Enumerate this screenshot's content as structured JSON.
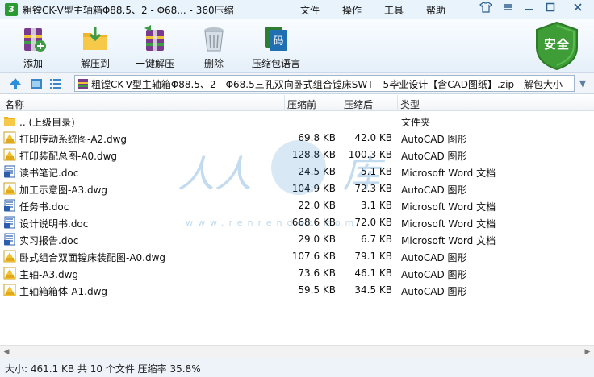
{
  "window": {
    "title": "粗镗CK-V型主轴箱Φ88.5、2 - Φ68... - 360压缩",
    "menu": [
      "文件",
      "操作",
      "工具",
      "帮助"
    ]
  },
  "toolbar": {
    "buttons": [
      {
        "label": "添加",
        "icon": "add-archive-icon"
      },
      {
        "label": "解压到",
        "icon": "extract-to-icon"
      },
      {
        "label": "一键解压",
        "icon": "one-click-extract-icon"
      },
      {
        "label": "删除",
        "icon": "trash-icon"
      },
      {
        "label": "压缩包语言",
        "icon": "archive-language-icon"
      }
    ],
    "security_label": "安全"
  },
  "address": {
    "path": "粗镗CK-V型主轴箱Φ88.5、2 - Φ68.5三孔双向卧式组合镗床SWT—5毕业设计【含CAD图纸】.zip - 解包大小"
  },
  "columns": {
    "name": "名称",
    "compressed": "压缩前",
    "packed": "压缩后",
    "type": "类型"
  },
  "files": [
    {
      "name": ".. (上级目录)",
      "before": "",
      "after": "",
      "type": "文件夹",
      "kind": "folder"
    },
    {
      "name": "打印传动系统图-A2.dwg",
      "before": "69.8 KB",
      "after": "42.0 KB",
      "type": "AutoCAD 图形",
      "kind": "dwg"
    },
    {
      "name": "打印装配总图-A0.dwg",
      "before": "128.8 KB",
      "after": "100.3 KB",
      "type": "AutoCAD 图形",
      "kind": "dwg"
    },
    {
      "name": "读书笔记.doc",
      "before": "24.5 KB",
      "after": "5.1 KB",
      "type": "Microsoft Word 文档",
      "kind": "doc"
    },
    {
      "name": "加工示意图-A3.dwg",
      "before": "104.9 KB",
      "after": "72.3 KB",
      "type": "AutoCAD 图形",
      "kind": "dwg"
    },
    {
      "name": "任务书.doc",
      "before": "22.0 KB",
      "after": "3.1 KB",
      "type": "Microsoft Word 文档",
      "kind": "doc"
    },
    {
      "name": "设计说明书.doc",
      "before": "668.6 KB",
      "after": "72.0 KB",
      "type": "Microsoft Word 文档",
      "kind": "doc"
    },
    {
      "name": "实习报告.doc",
      "before": "29.0 KB",
      "after": "6.7 KB",
      "type": "Microsoft Word 文档",
      "kind": "doc"
    },
    {
      "name": "卧式组合双面镗床装配图-A0.dwg",
      "before": "107.6 KB",
      "after": "79.1 KB",
      "type": "AutoCAD 图形",
      "kind": "dwg"
    },
    {
      "name": "主轴-A3.dwg",
      "before": "73.6 KB",
      "after": "46.1 KB",
      "type": "AutoCAD 图形",
      "kind": "dwg"
    },
    {
      "name": "主轴箱箱体-A1.dwg",
      "before": "59.5 KB",
      "after": "34.5 KB",
      "type": "AutoCAD 图形",
      "kind": "dwg"
    }
  ],
  "status": "大小: 461.1 KB 共 10 个文件 压缩率 35.8%",
  "watermark": "人人文库",
  "watermark_url": "www.renrendoc.com",
  "colors": {
    "accent": "#2b6cb0",
    "security_green": "#3f9d37",
    "dwg_yellow": "#f2c230",
    "doc_blue": "#2b5fad"
  }
}
